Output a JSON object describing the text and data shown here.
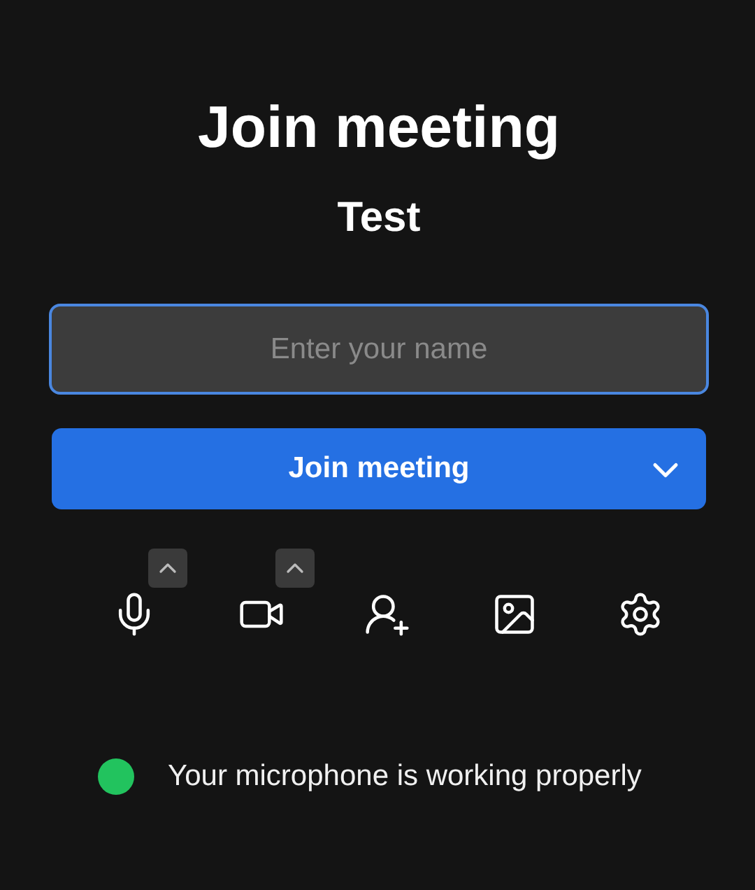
{
  "title": "Join meeting",
  "meeting_name": "Test",
  "name_field": {
    "placeholder": "Enter your name",
    "focused": true
  },
  "join_button": {
    "label": "Join meeting"
  },
  "toolbar": [
    {
      "kind": "microphone",
      "has_menu": true
    },
    {
      "kind": "camera",
      "has_menu": true
    },
    {
      "kind": "invite",
      "has_menu": false
    },
    {
      "kind": "background",
      "has_menu": false
    },
    {
      "kind": "settings",
      "has_menu": false
    }
  ],
  "status": {
    "text": "Your microphone is working properly",
    "color": "#22c35e"
  }
}
